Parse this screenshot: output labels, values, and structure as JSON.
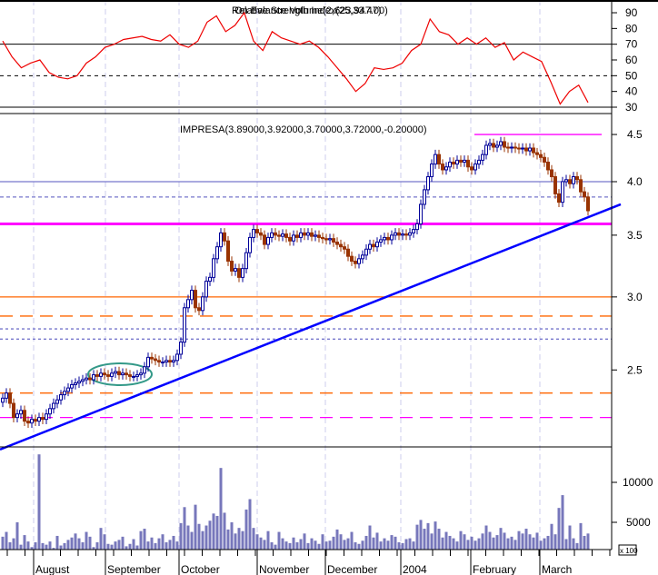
{
  "chart_data": [
    {
      "type": "line",
      "panel": "top",
      "title": "Relative Strength Index(25,33.47)",
      "title_overlay": "On Balance Volume(2,623,947.00)",
      "ylim": [
        25,
        95
      ],
      "yticks": [
        "90",
        "80",
        "70",
        "60",
        "50",
        "40",
        "30"
      ],
      "reference_lines": [
        {
          "value": 70,
          "style": "solid"
        },
        {
          "value": 50,
          "style": "dashed"
        },
        {
          "value": 30,
          "style": "solid"
        }
      ],
      "color": "#ee0000",
      "values": [
        72,
        62,
        55,
        58,
        60,
        52,
        49,
        48,
        50,
        58,
        62,
        68,
        70,
        73,
        74,
        75,
        73,
        72,
        76,
        70,
        68,
        72,
        84,
        88,
        78,
        82,
        90,
        72,
        66,
        78,
        74,
        72,
        70,
        72,
        68,
        62,
        55,
        48,
        40,
        45,
        55,
        54,
        55,
        58,
        66,
        70,
        86,
        78,
        76,
        70,
        74,
        70,
        74,
        68,
        71,
        60,
        65,
        62,
        59,
        46,
        32,
        40,
        44,
        33
      ]
    },
    {
      "type": "candlestick",
      "panel": "main",
      "title": "IMPRESA(3.89000,3.92000,3.70000,3.72000,-0.20000)",
      "scale": "log",
      "ylim": [
        2.05,
        4.72
      ],
      "yticks": [
        "4.5",
        "4.0",
        "3.5",
        "3.0",
        "2.5"
      ],
      "up_color": "#000099",
      "down_color": "#993300",
      "closes": [
        2.33,
        2.36,
        2.3,
        2.22,
        2.24,
        2.26,
        2.2,
        2.19,
        2.21,
        2.2,
        2.22,
        2.21,
        2.24,
        2.27,
        2.3,
        2.32,
        2.35,
        2.37,
        2.39,
        2.41,
        2.42,
        2.43,
        2.44,
        2.45,
        2.44,
        2.47,
        2.46,
        2.48,
        2.47,
        2.46,
        2.48,
        2.49,
        2.47,
        2.48,
        2.47,
        2.46,
        2.46,
        2.47,
        2.48,
        2.52,
        2.58,
        2.57,
        2.56,
        2.55,
        2.55,
        2.56,
        2.55,
        2.56,
        2.6,
        2.68,
        2.92,
        2.98,
        3.05,
        2.92,
        2.9,
        3.0,
        3.12,
        3.15,
        3.3,
        3.4,
        3.52,
        3.45,
        3.28,
        3.2,
        3.22,
        3.15,
        3.22,
        3.35,
        3.48,
        3.55,
        3.52,
        3.5,
        3.42,
        3.48,
        3.52,
        3.5,
        3.49,
        3.51,
        3.48,
        3.45,
        3.5,
        3.48,
        3.52,
        3.5,
        3.52,
        3.49,
        3.5,
        3.48,
        3.47,
        3.46,
        3.47,
        3.44,
        3.42,
        3.4,
        3.38,
        3.32,
        3.28,
        3.26,
        3.3,
        3.33,
        3.38,
        3.42,
        3.4,
        3.44,
        3.46,
        3.48,
        3.46,
        3.5,
        3.52,
        3.5,
        3.51,
        3.5,
        3.52,
        3.55,
        3.6,
        3.78,
        3.92,
        4.05,
        4.18,
        4.28,
        4.18,
        4.12,
        4.15,
        4.2,
        4.18,
        4.22,
        4.2,
        4.22,
        4.15,
        4.12,
        4.18,
        4.22,
        4.28,
        4.38,
        4.4,
        4.36,
        4.38,
        4.42,
        4.36,
        4.35,
        4.36,
        4.35,
        4.34,
        4.35,
        4.32,
        4.35,
        4.3,
        4.28,
        4.25,
        4.2,
        4.12,
        4.05,
        3.88,
        3.8,
        4.0,
        4.02,
        3.98,
        4.05,
        4.02,
        3.9,
        3.85,
        3.72
      ],
      "horizontal_lines": [
        {
          "value": 4.0,
          "color": "#7777cc",
          "style": "solid"
        },
        {
          "value": 3.85,
          "color": "#7777cc",
          "style": "dashed"
        },
        {
          "value": 3.6,
          "color": "#ff00ff",
          "style": "solid-thick"
        },
        {
          "value": 3.0,
          "color": "#ff6600",
          "style": "solid"
        },
        {
          "value": 2.86,
          "color": "#ff6600",
          "style": "dashed"
        },
        {
          "value": 2.77,
          "color": "#7777cc",
          "style": "dotted"
        },
        {
          "value": 2.7,
          "color": "#7777cc",
          "style": "dotted"
        },
        {
          "value": 2.36,
          "color": "#ff6600",
          "style": "dashed"
        },
        {
          "value": 2.22,
          "color": "#ff00ff",
          "style": "dashed"
        }
      ],
      "resistance_segment": {
        "value": 4.5,
        "color": "#ff00ff"
      },
      "trendline": {
        "color": "#0000ff",
        "from": 2.05,
        "to": 3.78
      },
      "ellipse_color": "#339988"
    },
    {
      "type": "bar",
      "panel": "volume",
      "yticks": [
        "10000",
        "5000"
      ],
      "unit_label": "x 100",
      "color": "#7777bb",
      "values": [
        3200,
        3800,
        2500,
        3000,
        5000,
        2200,
        3400,
        2600,
        1900,
        2500,
        13500,
        2400,
        2200,
        2600,
        1800,
        3300,
        2100,
        2400,
        2800,
        3100,
        3600,
        3000,
        2500,
        3800,
        3200,
        1900,
        2500,
        4300,
        3500,
        2300,
        2200,
        2600,
        2800,
        3200,
        2000,
        2300,
        2900,
        2100,
        3900,
        4200,
        2600,
        3100,
        2400,
        3000,
        3500,
        2500,
        2800,
        3300,
        2600,
        4900,
        6900,
        4600,
        3800,
        7200,
        4800,
        3900,
        4600,
        5200,
        6100,
        5800,
        11800,
        6200,
        4100,
        5000,
        3600,
        4300,
        3900,
        6600,
        7900,
        4300,
        3500,
        3100,
        2800,
        3900,
        2500,
        2200,
        3800,
        3000,
        2600,
        2400,
        3100,
        2500,
        2900,
        3600,
        2400,
        3000,
        2700,
        2300,
        3500,
        2600,
        2700,
        3200,
        4100,
        3500,
        2800,
        3000,
        3800,
        2500,
        2300,
        2700,
        3300,
        4600,
        3100,
        3700,
        2600,
        3000,
        2700,
        3400,
        3200,
        2500,
        2400,
        2900,
        3000,
        2600,
        4700,
        5300,
        4200,
        4900,
        3600,
        5100,
        4200,
        3100,
        3800,
        3300,
        3000,
        2600,
        3900,
        3500,
        2800,
        3200,
        2700,
        3000,
        3600,
        4600,
        3800,
        3100,
        3400,
        4300,
        3700,
        3000,
        3200,
        2800,
        3900,
        3600,
        4200,
        3500,
        3100,
        3700,
        2700,
        3000,
        3300,
        4800,
        3500,
        6800,
        8400,
        2900,
        4600,
        3000,
        2400,
        4900,
        3300,
        3600
      ]
    }
  ],
  "x_axis": {
    "months": [
      "August",
      "September",
      "October",
      "November",
      "December",
      "2004",
      "February",
      "March"
    ]
  },
  "colors": {
    "grid": "#ccccee",
    "axis": "#000000"
  }
}
